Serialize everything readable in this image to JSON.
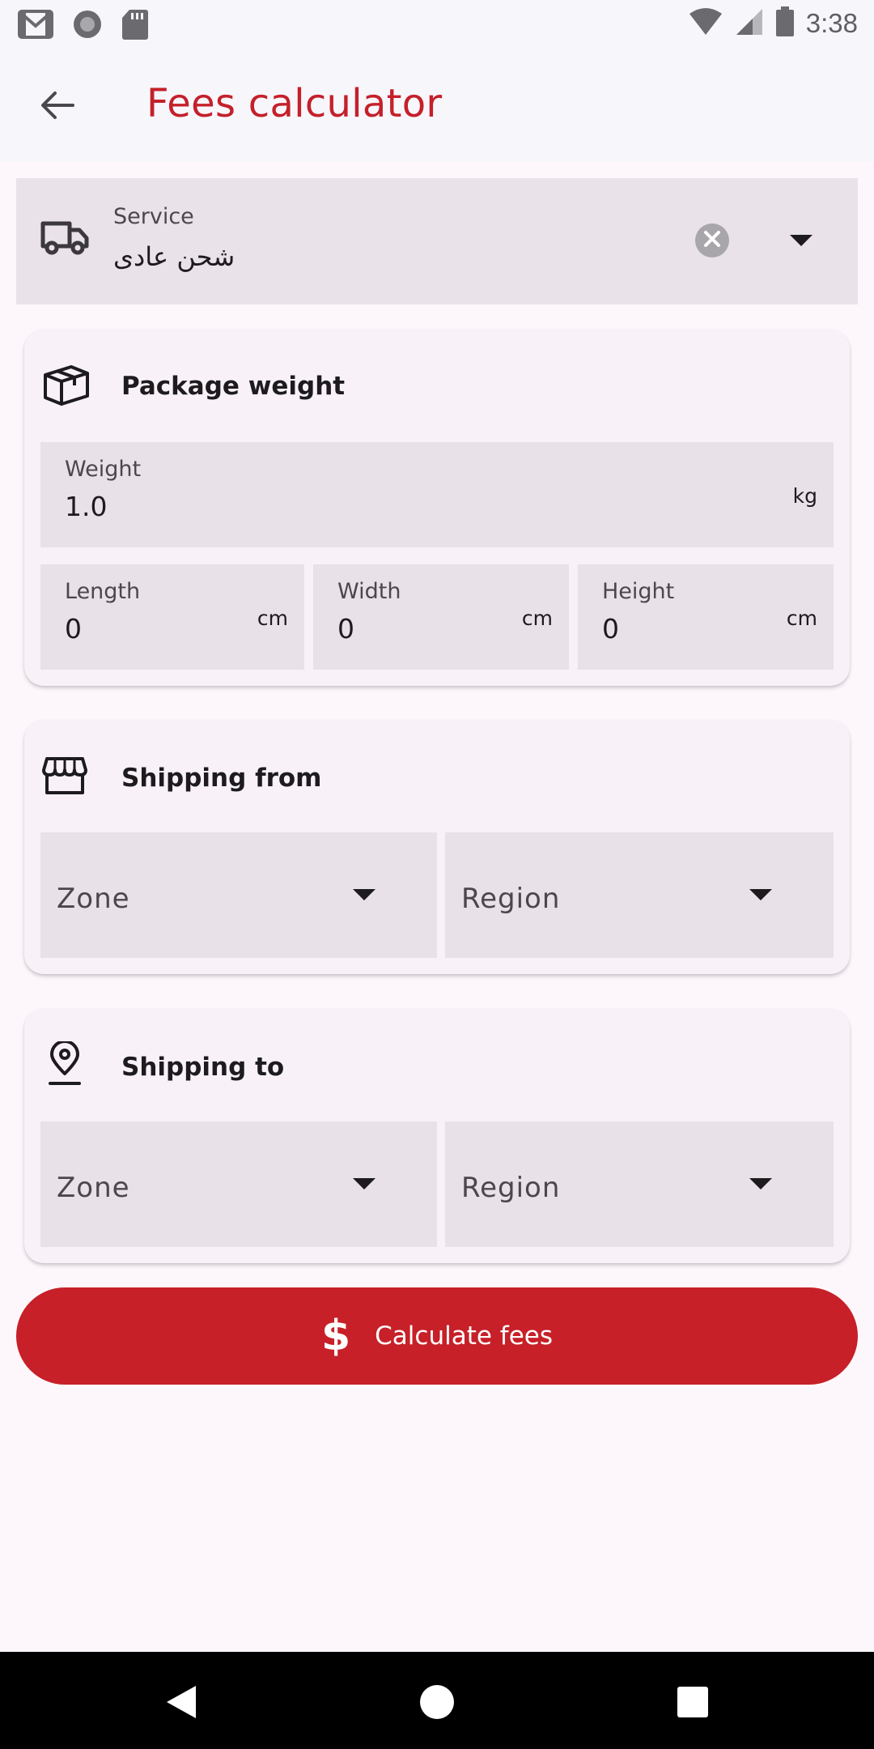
{
  "status_bar": {
    "time": "3:38",
    "left_icons": [
      "gmail-icon",
      "circle-notification-icon",
      "sd-card-icon"
    ],
    "right_icons": [
      "wifi-icon",
      "cell-signal-icon",
      "battery-icon"
    ]
  },
  "app_bar": {
    "title": "Fees calculator",
    "back_icon": "arrow-left-icon"
  },
  "service": {
    "label": "Service",
    "value": "شحن عادى",
    "icon": "truck-icon"
  },
  "package_card": {
    "title": "Package weight",
    "icon": "box-icon",
    "weight": {
      "label": "Weight",
      "value": "1.0",
      "unit": "kg"
    },
    "length": {
      "label": "Length",
      "value": "0",
      "unit": "cm"
    },
    "width": {
      "label": "Width",
      "value": "0",
      "unit": "cm"
    },
    "height": {
      "label": "Height",
      "value": "0",
      "unit": "cm"
    }
  },
  "shipping_from": {
    "title": "Shipping from",
    "icon": "store-icon",
    "zone_label": "Zone",
    "region_label": "Region"
  },
  "shipping_to": {
    "title": "Shipping to",
    "icon": "location-pin-icon",
    "zone_label": "Zone",
    "region_label": "Region"
  },
  "calculate_button": {
    "label": "Calculate fees",
    "icon_glyph": "$"
  },
  "colors": {
    "accent": "#c72028",
    "title": "#c4202a",
    "field_bg": "#e8e1e7",
    "card_bg": "#f8f2f8"
  }
}
